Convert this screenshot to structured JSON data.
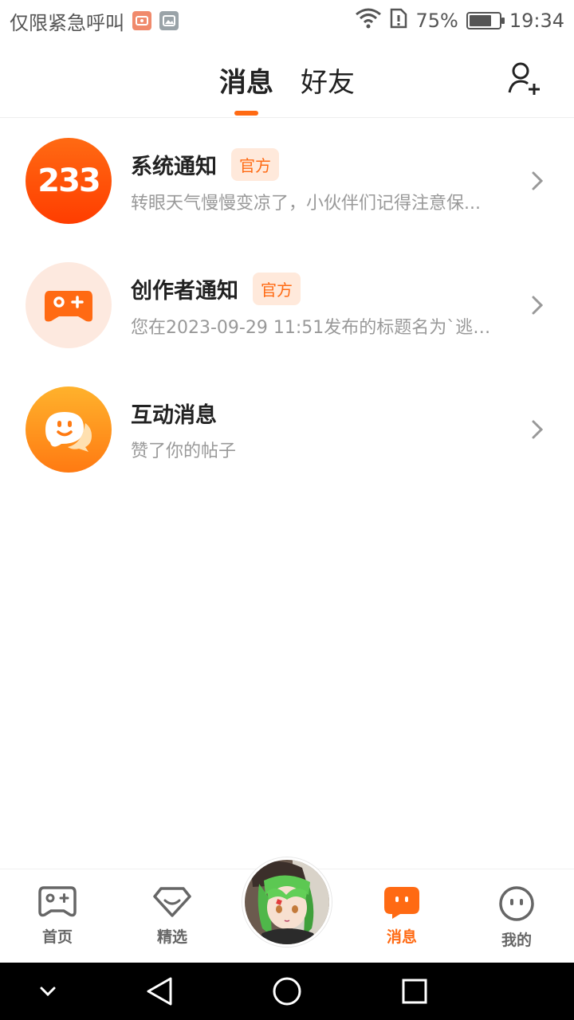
{
  "status_bar": {
    "carrier": "仅限紧急呼叫",
    "battery_percent": "75%",
    "battery_level": 0.75,
    "time": "19:34"
  },
  "header": {
    "tabs": [
      {
        "label": "消息",
        "active": true
      },
      {
        "label": "好友",
        "active": false
      }
    ]
  },
  "messages": [
    {
      "title": "系统通知",
      "badge": "官方",
      "preview": "转眼天气慢慢变凉了，小伙伴们记得注意保...",
      "avatar_text": "233"
    },
    {
      "title": "创作者通知",
      "badge": "官方",
      "preview": "您在2023-09-29 11:51发布的标题名为`逃离..."
    },
    {
      "title": "互动消息",
      "preview": "赞了你的帖子"
    }
  ],
  "bottom_nav": [
    {
      "label": "首页",
      "icon": "gamepad-icon",
      "active": false
    },
    {
      "label": "精选",
      "icon": "heart-diamond-icon",
      "active": false
    },
    {
      "label": "消息",
      "icon": "chat-bubble-icon",
      "active": true
    },
    {
      "label": "我的",
      "icon": "face-icon",
      "active": false
    }
  ],
  "colors": {
    "accent": "#ff6a13",
    "badge_bg": "#ffe9db",
    "muted_text": "#999999"
  }
}
